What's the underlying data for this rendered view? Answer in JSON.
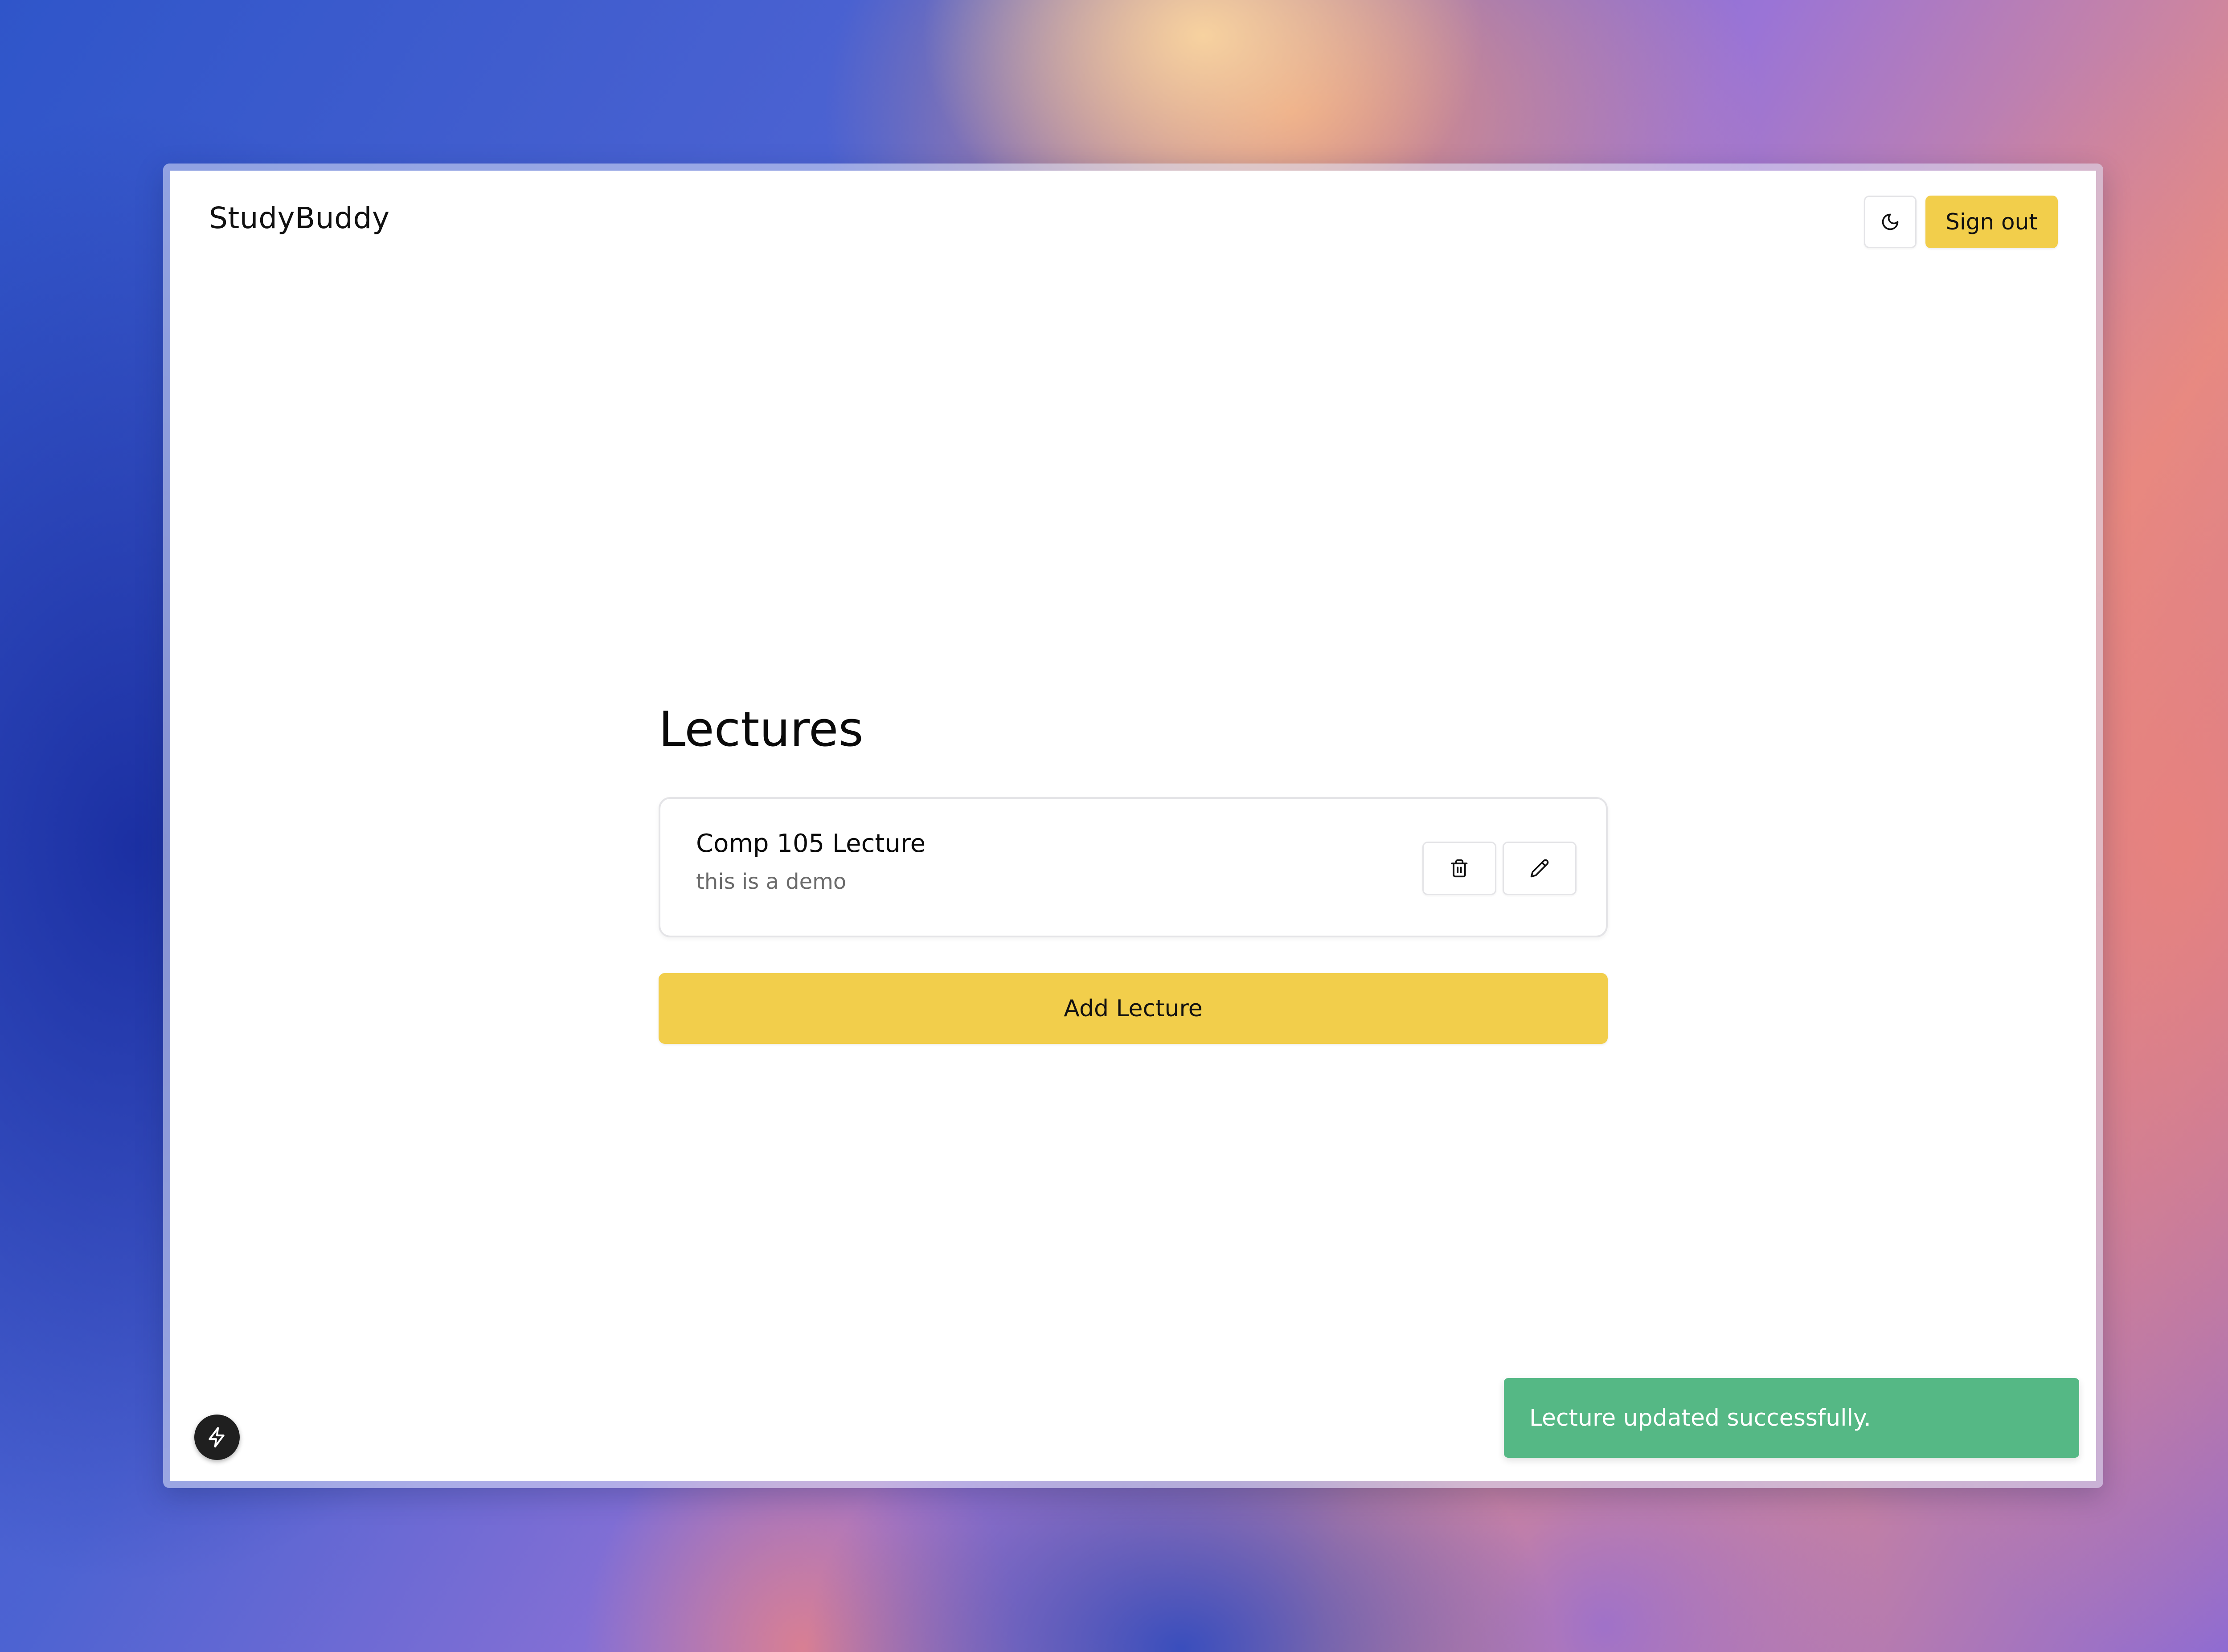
{
  "app": {
    "brand": "StudyBuddy"
  },
  "header": {
    "theme_toggle_icon": "moon-icon",
    "sign_out_label": "Sign out"
  },
  "main": {
    "title": "Lectures",
    "lectures": [
      {
        "title": "Comp 105 Lecture",
        "description": "this is a demo",
        "actions": [
          "trash-icon",
          "pencil-icon"
        ]
      }
    ],
    "add_button_label": "Add Lecture"
  },
  "toast": {
    "message": "Lecture updated successfully."
  },
  "dev_badge": {
    "icon": "lightning-icon"
  },
  "colors": {
    "accent": "#f2ce4b",
    "toast_success": "#55b885",
    "muted_text": "#6b6b6b",
    "border": "#e4e4e7"
  }
}
